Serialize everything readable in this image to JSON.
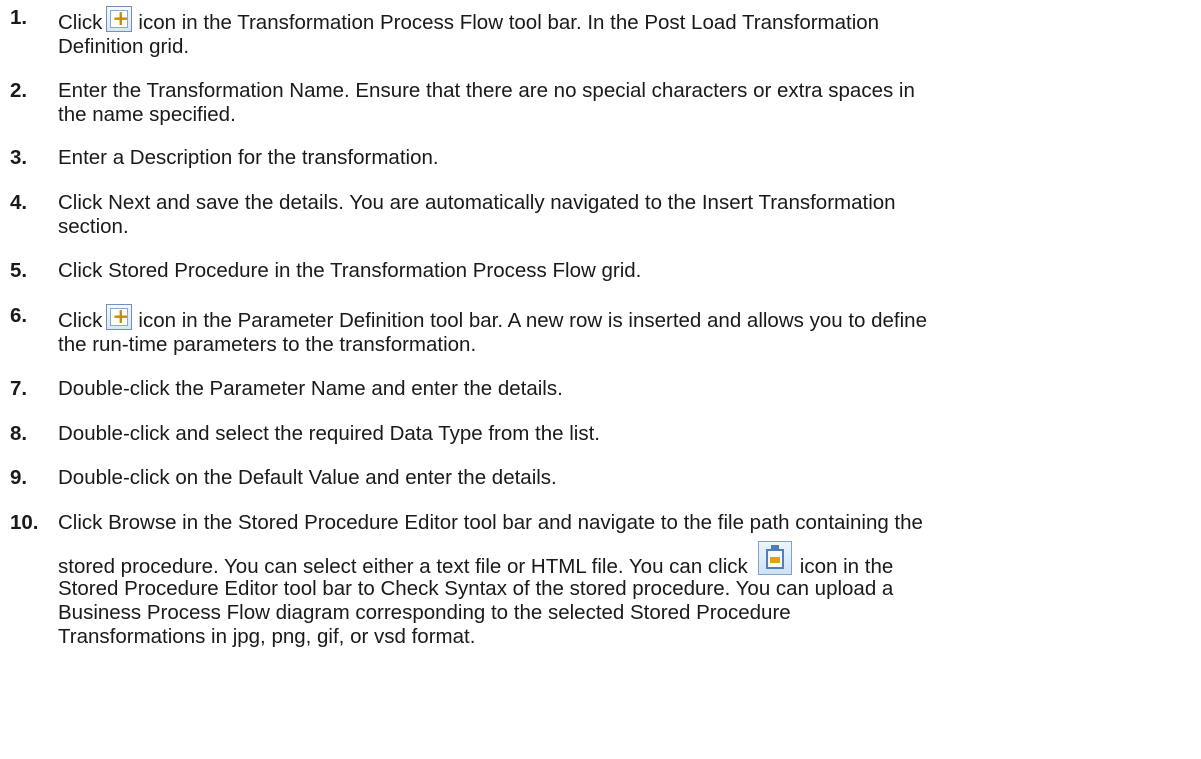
{
  "steps": [
    {
      "number": "1.",
      "before_icon": "Click",
      "icon": "add-row-icon",
      "after_icon": "icon in the Transformation Process Flow tool bar. In the Post Load Transformation",
      "line2": "Definition grid."
    },
    {
      "number": "2.",
      "line1": "Enter the Transformation Name. Ensure that there are no special characters or extra spaces in",
      "line2": "the name specified."
    },
    {
      "number": "3.",
      "line1": "Enter a Description for the transformation."
    },
    {
      "number": "4.",
      "line1": "Click Next and save the details. You are automatically navigated to the Insert Transformation",
      "line2": "section."
    },
    {
      "number": "5.",
      "line1": "Click Stored Procedure in the Transformation Process Flow grid."
    },
    {
      "number": "6.",
      "before_icon": "Click",
      "icon": "add-row-icon",
      "after_icon": "icon in the Parameter Definition tool bar. A new row is inserted and allows you to define",
      "line2": "the run-time parameters to the transformation."
    },
    {
      "number": "7.",
      "line1": "Double-click the Parameter Name and enter the details."
    },
    {
      "number": "8.",
      "line1": "Double-click and select the required Data Type from the list."
    },
    {
      "number": "9.",
      "line1": "Double-click on the Default Value and enter the details."
    },
    {
      "number": "10.",
      "line1": "Click Browse in the Stored Procedure Editor tool bar and navigate to the file path containing the",
      "line2_before_icon": "stored procedure. You can select either a text file or HTML file. You can click",
      "icon": "check-syntax-icon",
      "line2_after_icon": "icon in the",
      "line3": "Stored Procedure Editor tool bar to Check Syntax of the stored procedure. You can upload a",
      "line4": "Business Process Flow diagram corresponding to the selected Stored Procedure",
      "line5": "Transformations in jpg, png, gif, or vsd format."
    }
  ]
}
